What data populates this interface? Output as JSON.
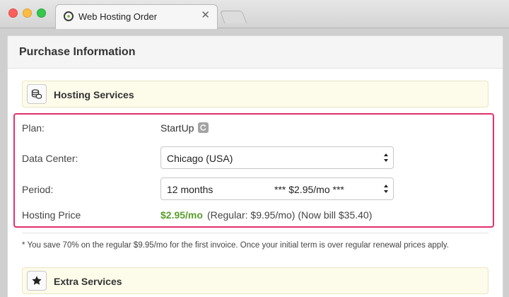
{
  "browser": {
    "tab_title": "Web Hosting Order",
    "close_glyph": "✕"
  },
  "page": {
    "title": "Purchase Information"
  },
  "hosting_section": {
    "label": "Hosting Services",
    "icon": "database-icon"
  },
  "form": {
    "plan": {
      "label": "Plan:",
      "value": "StartUp"
    },
    "data_center": {
      "label": "Data Center:",
      "selected": "Chicago (USA)"
    },
    "period": {
      "label": "Period:",
      "selected": "12 months",
      "price_tag": "*** $2.95/mo ***"
    },
    "hosting_price": {
      "label": "Hosting Price",
      "price": "$2.95/mo",
      "details": "(Regular: $9.95/mo) (Now bill $35.40)"
    }
  },
  "note": "* You save 70% on the regular $9.95/mo for the first invoice. Once your initial term is over regular renewal prices apply.",
  "extra_section": {
    "label": "Extra Services",
    "icon": "star-icon"
  },
  "colors": {
    "highlight": "#e2316d",
    "price_green": "#5a9e2e",
    "section_bg": "#fdfbe9"
  }
}
